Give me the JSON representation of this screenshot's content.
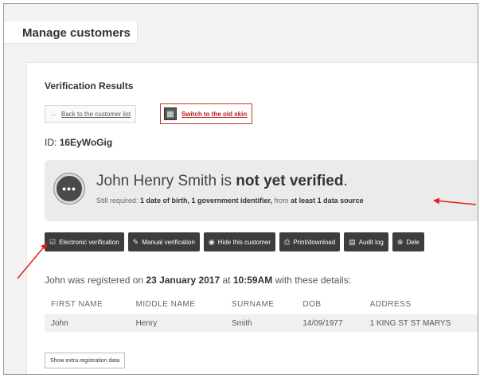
{
  "page": {
    "title": "Manage customers"
  },
  "section": {
    "title": "Verification Results"
  },
  "nav": {
    "back_label": "Back to the customer list",
    "back_icon": "arrow-left-icon",
    "skin_label": "Switch to the old skin",
    "skin_icon": "skin-icon"
  },
  "customer": {
    "id_label": "ID:",
    "id_value": "16EyWoGig"
  },
  "status": {
    "icon": "ellipsis-circle-icon",
    "name": "John Henry Smith",
    "is": " is ",
    "state": "not yet verified",
    "period": ".",
    "sub_prefix": "Still required: ",
    "sub_items": "1 date of birth, 1 government identifier,",
    "sub_mid": " from ",
    "sub_source": "at least 1 data source"
  },
  "toolbar": {
    "buttons": [
      {
        "label": "Electronic verification",
        "icon": "check-square-icon"
      },
      {
        "label": "Manual verification",
        "icon": "pencil-icon"
      },
      {
        "label": "Hide this customer",
        "icon": "eye-icon"
      },
      {
        "label": "Print/download",
        "icon": "print-icon"
      },
      {
        "label": "Audit log",
        "icon": "clipboard-icon"
      },
      {
        "label": "Dele",
        "icon": "remove-icon"
      }
    ]
  },
  "registration": {
    "prefix": "John was registered on ",
    "date": "23 January 2017",
    "at": " at ",
    "time": "10:59AM",
    "suffix": " with these details:"
  },
  "table": {
    "headers": [
      "FIRST NAME",
      "MIDDLE NAME",
      "SURNAME",
      "DOB",
      "ADDRESS"
    ],
    "rows": [
      [
        "John",
        "Henry",
        "Smith",
        "14/09/1977",
        "1 KING ST ST MARYS"
      ]
    ]
  },
  "extra": {
    "label": "Show extra registration data"
  },
  "colors": {
    "annotation_arrow": "#e02020",
    "toolbar_bg": "#3d3d3d",
    "status_bg": "#ebebeb",
    "skin_border": "#c0392b"
  }
}
